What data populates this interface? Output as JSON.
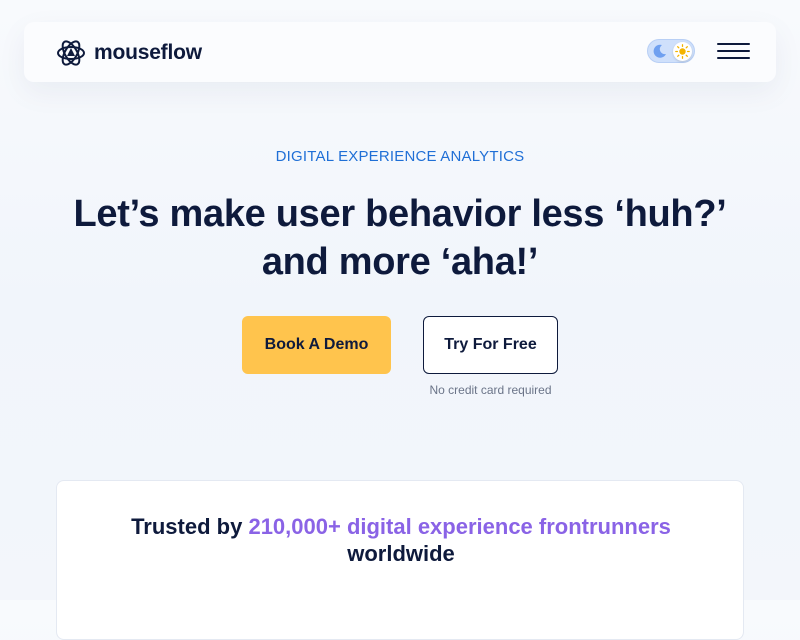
{
  "header": {
    "brand": "mouseflow",
    "theme_toggle": {
      "state": "light",
      "icons": [
        "moon-icon",
        "sun-icon"
      ]
    },
    "menu_icon": "hamburger-icon"
  },
  "hero": {
    "eyebrow": "DIGITAL EXPERIENCE ANALYTICS",
    "headline_line1": "Let’s make user behavior less ‘huh?’",
    "headline_line2": "and more ‘aha!’",
    "primary_cta": "Book A Demo",
    "secondary_cta": "Try For Free",
    "secondary_note": "No credit card required"
  },
  "trust": {
    "prefix": "Trusted by",
    "highlight": "210,000+ digital experience frontrunners",
    "suffix": "worldwide"
  },
  "colors": {
    "brand_navy": "#0e1a3c",
    "accent_blue": "#1f6fd6",
    "cta_yellow": "#ffc44d",
    "highlight_purple": "#8a63e6"
  }
}
